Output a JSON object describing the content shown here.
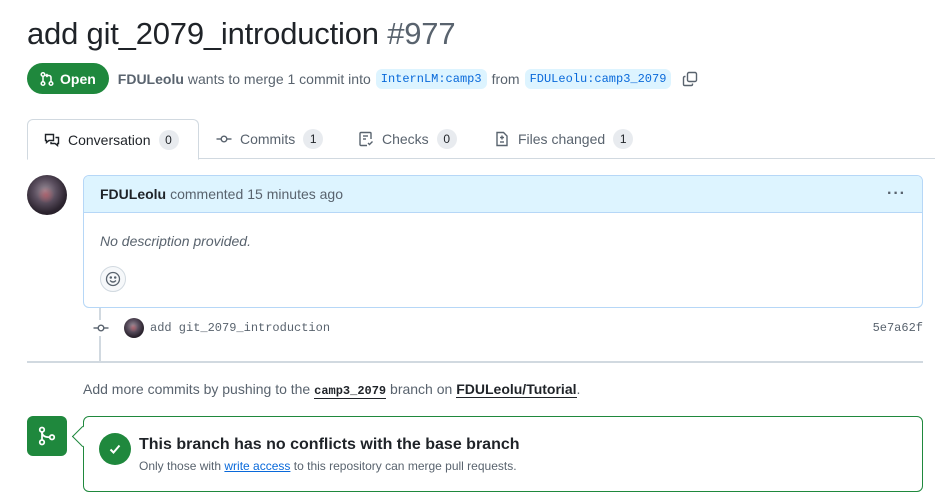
{
  "pr": {
    "title": "add git_2079_introduction",
    "number": "#977",
    "state": "Open",
    "author": "FDULeolu",
    "merge_text_1": "wants to merge 1 commit into",
    "base_branch": "InternLM:camp3",
    "from_text": "from",
    "head_branch": "FDULeolu:camp3_2079"
  },
  "tabs": [
    {
      "label": "Conversation",
      "count": "0",
      "icon": "comment-discussion-icon"
    },
    {
      "label": "Commits",
      "count": "1",
      "icon": "git-commit-icon"
    },
    {
      "label": "Checks",
      "count": "0",
      "icon": "checklist-icon"
    },
    {
      "label": "Files changed",
      "count": "1",
      "icon": "file-diff-icon"
    }
  ],
  "comment": {
    "author": "FDULeolu",
    "action": "commented",
    "time": "15 minutes ago",
    "menu": "···",
    "body": "No description provided."
  },
  "commit": {
    "message": "add git_2079_introduction",
    "sha": "5e7a62f"
  },
  "push_note": {
    "prefix": "Add more commits by pushing to the",
    "branch": "camp3_2079",
    "middle": "branch on",
    "repo": "FDULeolu/Tutorial",
    "suffix": "."
  },
  "merge": {
    "title": "This branch has no conflicts with the base branch",
    "sub_prefix": "Only those with",
    "sub_link": "write access",
    "sub_suffix": "to this repository can merge pull requests."
  },
  "colors": {
    "open_green": "#1f883d",
    "link_blue": "#0969da",
    "branch_bg": "#ddf4ff"
  }
}
